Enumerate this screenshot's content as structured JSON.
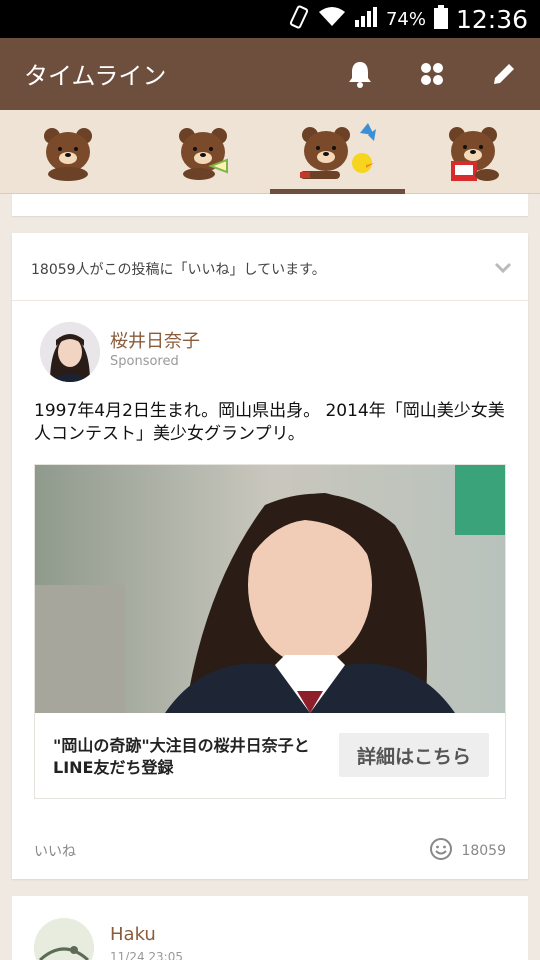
{
  "status_bar": {
    "battery_percent": "74%",
    "time": "12:36",
    "icons": [
      "vibrate-icon",
      "wifi-icon",
      "signal-icon",
      "battery-icon"
    ]
  },
  "header": {
    "title": "タイムライン",
    "icons": [
      "bell-icon",
      "grid-icon",
      "pencil-icon"
    ],
    "background_color": "#6e4e3d"
  },
  "sticker_tabs": {
    "items": [
      "brown-bear-sticker",
      "brown-bear-sandwich-sticker",
      "brown-bear-butterfly-sticker",
      "brown-bear-reading-sticker"
    ],
    "selected_index": 2
  },
  "post": {
    "like_banner": "18059人がこの投稿に「いいね」しています。",
    "author": "桜井日奈子",
    "sponsored_label": "Sponsored",
    "body": "1997年4月2日生まれ。岡山県出身。 2014年「岡山美少女美人コンテスト」美少女グランプリ。",
    "ad": {
      "caption": "\"岡山の奇跡\"大注目の桜井日奈子とLINE友だち登録",
      "button_label": "詳細はこちら"
    },
    "like_label": "いいね",
    "like_count": "18059"
  },
  "next_post": {
    "author": "Haku",
    "time": "11/24 23:05"
  }
}
